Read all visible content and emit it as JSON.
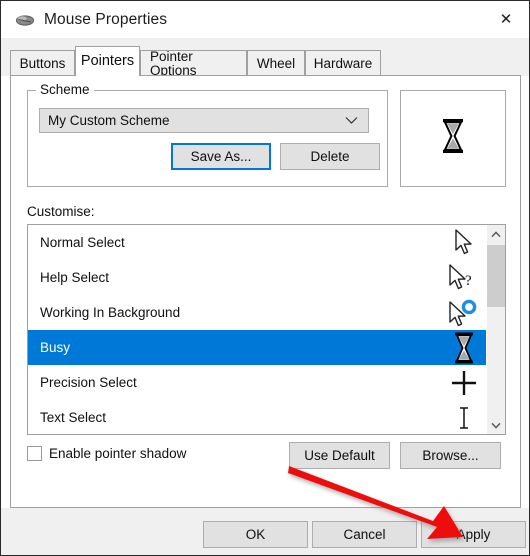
{
  "window": {
    "title": "Mouse Properties",
    "icon": "mouse-icon",
    "close_label": "✕"
  },
  "tabs": [
    {
      "label": "Buttons",
      "active": false
    },
    {
      "label": "Pointers",
      "active": true
    },
    {
      "label": "Pointer Options",
      "active": false
    },
    {
      "label": "Wheel",
      "active": false
    },
    {
      "label": "Hardware",
      "active": false
    }
  ],
  "scheme": {
    "legend": "Scheme",
    "selected": "My Custom Scheme",
    "dropdown_icon": "chevron-down-icon",
    "save_as_label": "Save As...",
    "delete_label": "Delete",
    "save_as_focused": true
  },
  "preview": {
    "cursor": "hourglass-busy-cursor"
  },
  "customise": {
    "label": "Customise:",
    "items": [
      {
        "label": "Normal Select",
        "icon": "arrow-cursor-icon",
        "selected": false
      },
      {
        "label": "Help Select",
        "icon": "arrow-question-cursor-icon",
        "selected": false
      },
      {
        "label": "Working In Background",
        "icon": "arrow-spinner-cursor-icon",
        "selected": false
      },
      {
        "label": "Busy",
        "icon": "hourglass-cursor-icon",
        "selected": true
      },
      {
        "label": "Precision Select",
        "icon": "crosshair-cursor-icon",
        "selected": false
      },
      {
        "label": "Text Select",
        "icon": "ibeam-cursor-icon",
        "selected": false
      }
    ],
    "scrollbar": {
      "up_icon": "chevron-up-icon",
      "down_icon": "chevron-down-icon"
    }
  },
  "options": {
    "pointer_shadow_label": "Enable pointer shadow",
    "pointer_shadow_checked": false,
    "use_default_label": "Use Default",
    "browse_label": "Browse..."
  },
  "footer": {
    "ok_label": "OK",
    "cancel_label": "Cancel",
    "apply_label": "Apply"
  },
  "annotation": {
    "type": "red-arrow",
    "color": "#ee1111",
    "points_to": "Apply"
  },
  "colors": {
    "selection_blue": "#0078d7",
    "focus_blue": "#0078d7",
    "button_face": "#e1e1e1",
    "dialog_face": "#f0f0f0",
    "annotation_red": "#ee1111"
  }
}
